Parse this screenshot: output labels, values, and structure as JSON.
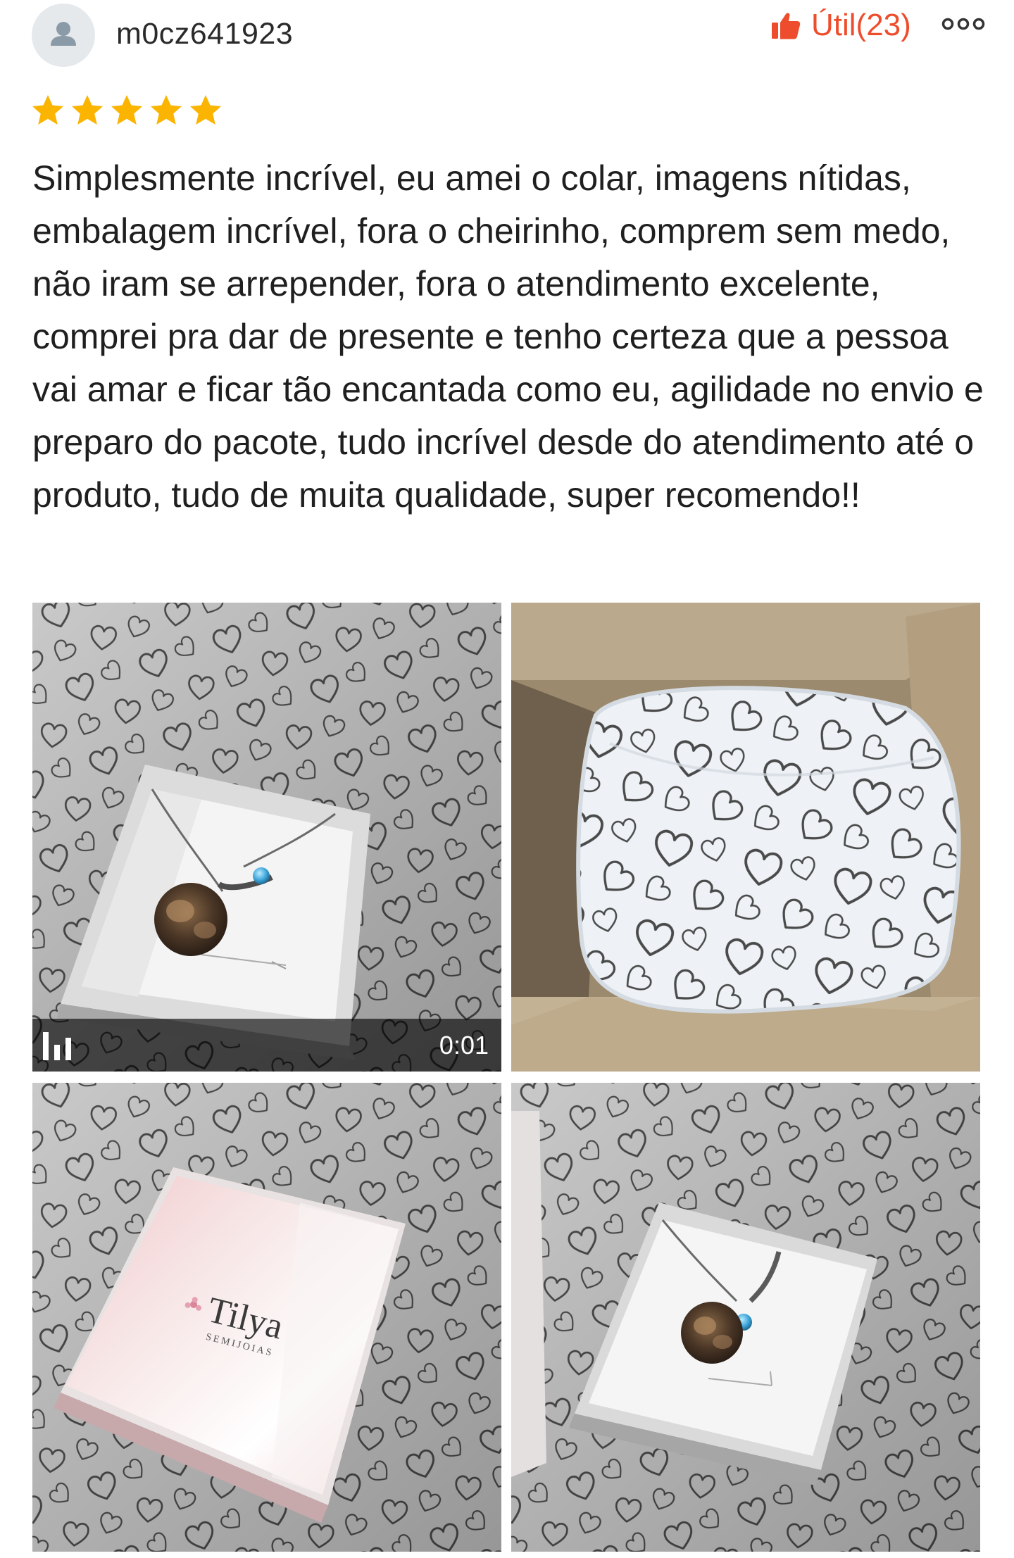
{
  "review": {
    "username": "m0cz641923",
    "helpful_label": "Útil(23)",
    "rating": 5,
    "text": "Simplesmente incrível, eu amei o colar, imagens nítidas, embalagem incrível, fora o cheirinho, comprem sem medo, não iram se arrepender, fora o atendimento excelente, comprei pra dar de presente e tenho certeza que a pessoa vai amar e ficar tão encantada como eu, agilidade no envio e preparo do pacote, tudo incrível desde do atendimento até o produto, tudo de muita qualidade, super recomendo!!"
  },
  "media": {
    "video_duration": "0:01",
    "box_brand": "Tilya",
    "box_brand_sub": "SEMIJOIAS"
  },
  "icons": {
    "avatar": "user-silhouette-icon",
    "helpful": "thumbs-up-icon",
    "more": "more-options-icon",
    "star": "star-icon",
    "video": "video-bars-icon"
  },
  "colors": {
    "accent": "#ee4d2d",
    "star": "#fbb400",
    "avatar_bg": "#e6e9ec",
    "avatar_fg": "#8a9aa6"
  }
}
